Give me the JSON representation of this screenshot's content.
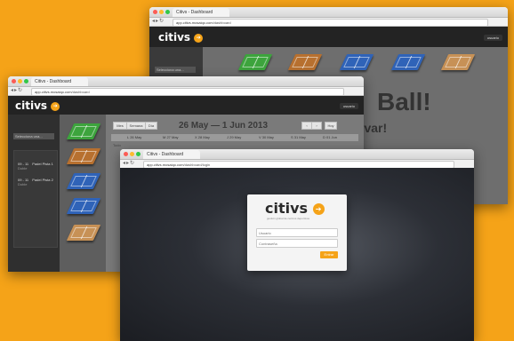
{
  "back_window": {
    "tab_title": "Citivs - Dashboard",
    "url_host": "app.citivs.mosaiqo.com",
    "url_path": "/dashboard",
    "brand": "citivs",
    "user_menu": "usuario",
    "sidebar_select": "Selecciona una...",
    "headline": "Ball!",
    "subline": "rvar!"
  },
  "mid_window": {
    "tab_title": "Citivs - Dashboard",
    "url_host": "app.citivs.mosaiqo.com",
    "url_path": "/dashboard",
    "brand": "citivs",
    "user_menu": "usuario",
    "sidebar_select": "Selecciona una...",
    "view_buttons": [
      "Mes",
      "Semana",
      "Día"
    ],
    "date_range": "26 May — 1 Jun 2013",
    "day_headers": [
      "L 26 May",
      "M 27 May",
      "X 28 May",
      "J 29 May",
      "V 30 May",
      "S 31 May",
      "D 01 Jun"
    ],
    "allday_label": "Todo",
    "events": [
      {
        "time": "09 - 11",
        "place": "Padel Pista 1",
        "sub": "Doble"
      },
      {
        "time": "09 - 11",
        "place": "Padel Pista 2",
        "sub": "Doble"
      }
    ],
    "today_button": "Hoy"
  },
  "front_window": {
    "tab_title": "Citivs - Dashboard",
    "url_host": "app.citivs.mosaiqo.com",
    "url_path": "/dashboard/login",
    "brand": "citivs",
    "tagline": "gestión global de centros deportivos",
    "username_placeholder": "Usuario",
    "password_placeholder": "Contraseña",
    "login_button": "Entrar"
  },
  "colors": {
    "background": "#f5a318",
    "accent": "#f5a318",
    "app_dark": "#232323"
  }
}
